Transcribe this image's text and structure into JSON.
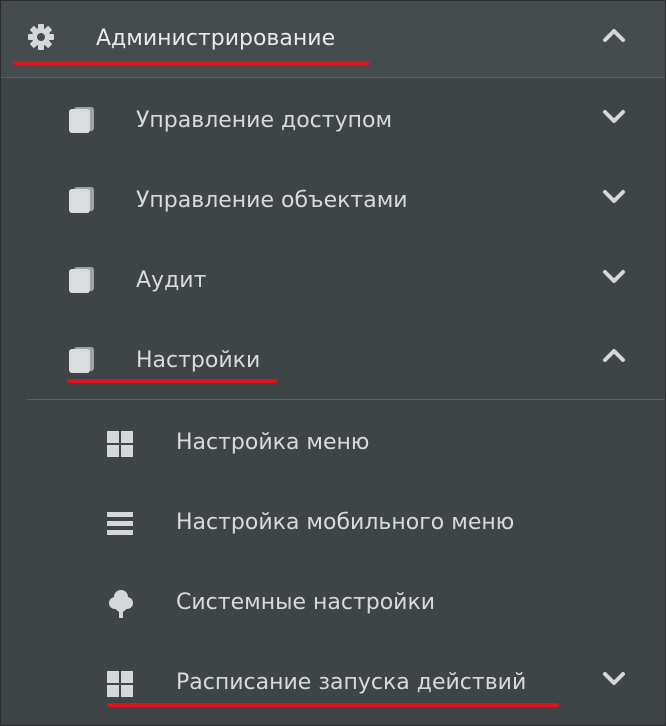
{
  "menu": {
    "root": {
      "label": "Администрирование",
      "icon": "gear-icon",
      "expanded": true,
      "highlighted": true
    },
    "items": [
      {
        "label": "Управление доступом",
        "icon": "book-icon",
        "expanded": false
      },
      {
        "label": "Управление объектами",
        "icon": "book-icon",
        "expanded": false
      },
      {
        "label": "Аудит",
        "icon": "book-icon",
        "expanded": false
      },
      {
        "label": "Настройки",
        "icon": "book-icon",
        "expanded": true,
        "highlighted": true
      }
    ],
    "subitems": [
      {
        "label": "Настройка меню",
        "icon": "grid-icon"
      },
      {
        "label": "Настройка мобильного меню",
        "icon": "list-icon"
      },
      {
        "label": "Системные настройки",
        "icon": "tree-icon"
      },
      {
        "label": "Расписание запуска действий",
        "icon": "grid-icon",
        "expanded": false,
        "highlighted": true
      }
    ]
  },
  "colors": {
    "background": "#3f4447",
    "header_background": "#464b4e",
    "text": "#d7dadb",
    "icon": "#d5d8d9",
    "highlight_underline": "#e1111f"
  }
}
